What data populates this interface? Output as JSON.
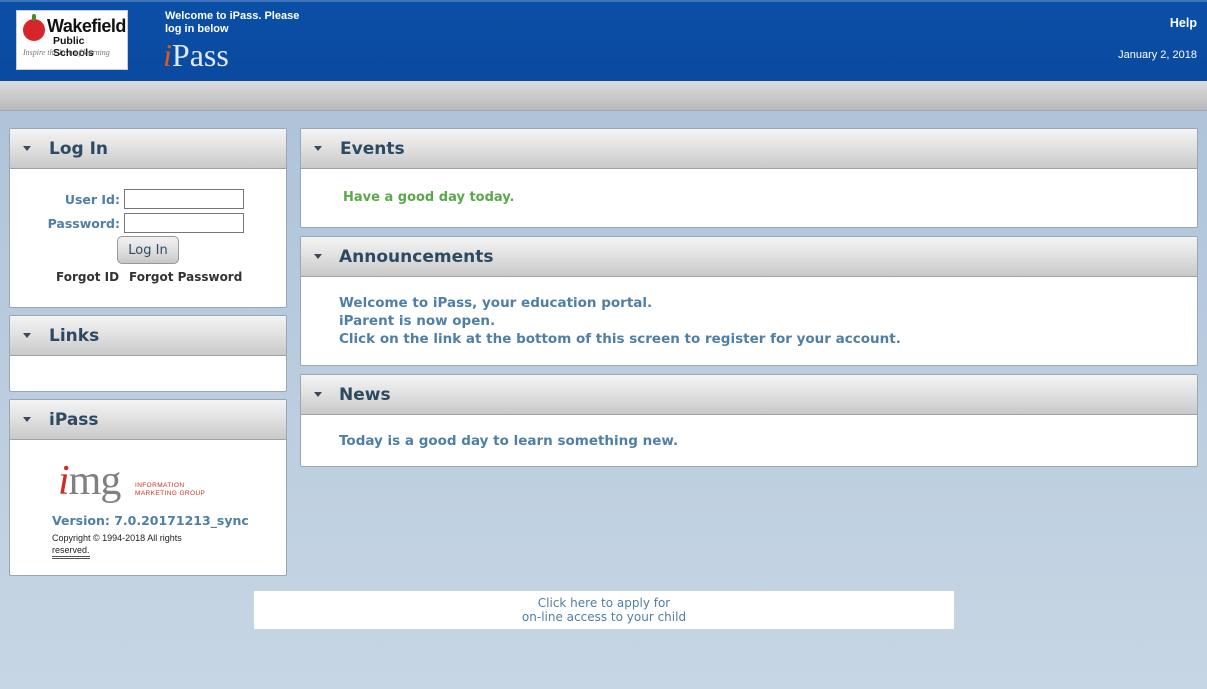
{
  "header": {
    "logo": {
      "line1": "Wakefield",
      "line2": "Public Schools",
      "tagline": "Inspire the love of learning"
    },
    "welcome_line1": "Welcome to iPass. Please",
    "welcome_line2": "log in below",
    "brand_i": "i",
    "brand_rest": "Pass",
    "help_label": "Help",
    "date": "January 2, 2018"
  },
  "login": {
    "title": "Log In",
    "userid_label": "User Id:",
    "password_label": "Password:",
    "userid_value": "",
    "password_value": "",
    "button_label": "Log In",
    "forgot_id": "Forgot ID",
    "forgot_password": "Forgot Password"
  },
  "links": {
    "title": "Links"
  },
  "ipass": {
    "title": "iPass",
    "logo_i": "i",
    "logo_rest": "mg",
    "logo_tag_line1": "INFORMATION",
    "logo_tag_line2": "MARKETING GROUP",
    "version": "Version: 7.0.20171213_sync",
    "copyright_line1": "Copyright © 1994-2018  All rights",
    "copyright_line2": "reserved."
  },
  "events": {
    "title": "Events",
    "text": "Have a good day today."
  },
  "announcements": {
    "title": "Announcements",
    "lines": [
      "Welcome to iPass, your education portal.",
      "iParent is now open.",
      "Click on the link at the bottom of this screen to register for your account."
    ]
  },
  "news": {
    "title": "News",
    "text": "Today is a good day to learn something new."
  },
  "apply": {
    "line1": "Click here to apply for",
    "line2": "on-line access to your child"
  },
  "colors": {
    "header_blue": "#0a4aa0",
    "panel_title": "#2d4a62",
    "body_text_blue": "#4f7fa6",
    "events_green": "#5aa84a"
  }
}
